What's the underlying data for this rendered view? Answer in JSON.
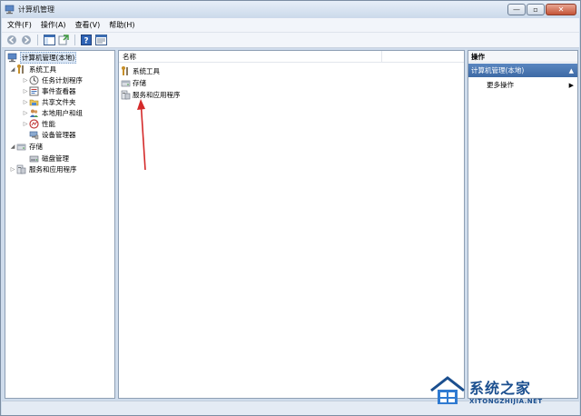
{
  "window": {
    "title": "计算机管理",
    "buttons": {
      "minimize": "—",
      "maximize": "▫",
      "close": "✕"
    }
  },
  "menubar": {
    "items": [
      {
        "label": "文件(F)"
      },
      {
        "label": "操作(A)"
      },
      {
        "label": "查看(V)"
      },
      {
        "label": "帮助(H)"
      }
    ]
  },
  "toolbar": {
    "buttons": [
      "back-arrow-icon",
      "forward-arrow-icon",
      "show-hide-tree-icon",
      "export-list-icon",
      "help-icon",
      "properties-icon"
    ]
  },
  "tree": {
    "root": "计算机管理(本地)",
    "system_tools": "系统工具",
    "task_scheduler": "任务计划程序",
    "event_viewer": "事件查看器",
    "shared_folders": "共享文件夹",
    "local_users": "本地用户和组",
    "performance": "性能",
    "device_manager": "设备管理器",
    "storage": "存储",
    "disk_management": "磁盘管理",
    "services_apps": "服务和应用程序"
  },
  "list": {
    "column_name": "名称",
    "rows": [
      {
        "label": "系统工具"
      },
      {
        "label": "存储"
      },
      {
        "label": "服务和应用程序"
      }
    ]
  },
  "actions": {
    "title": "操作",
    "section": "计算机管理(本地)",
    "more": "更多操作",
    "arrow_up": "▲",
    "arrow_right": "▶"
  },
  "watermark": {
    "main": "系统之家",
    "sub": "XITONGZHIJIA.NET"
  },
  "colors": {
    "accent": "#3d6aa5",
    "annotation": "#d42a2a",
    "watermark": "#1b4f8f"
  }
}
